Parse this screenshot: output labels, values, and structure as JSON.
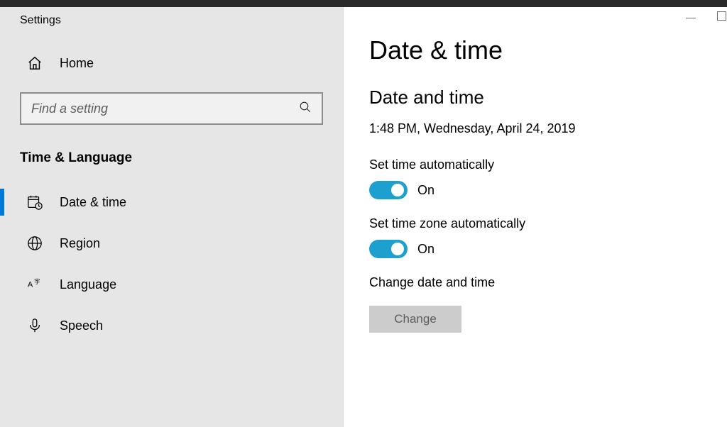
{
  "window": {
    "app_title": "Settings",
    "home_label": "Home",
    "search_placeholder": "Find a setting",
    "category_heading": "Time & Language",
    "nav": [
      {
        "label": "Date & time"
      },
      {
        "label": "Region"
      },
      {
        "label": "Language"
      },
      {
        "label": "Speech"
      }
    ]
  },
  "main": {
    "page_title": "Date & time",
    "section_title": "Date and time",
    "current_datetime": "1:48 PM, Wednesday, April 24, 2019",
    "set_time_auto": {
      "label": "Set time automatically",
      "state": "On"
    },
    "set_tz_auto": {
      "label": "Set time zone automatically",
      "state": "On"
    },
    "change_block": {
      "label": "Change date and time",
      "button": "Change"
    }
  }
}
